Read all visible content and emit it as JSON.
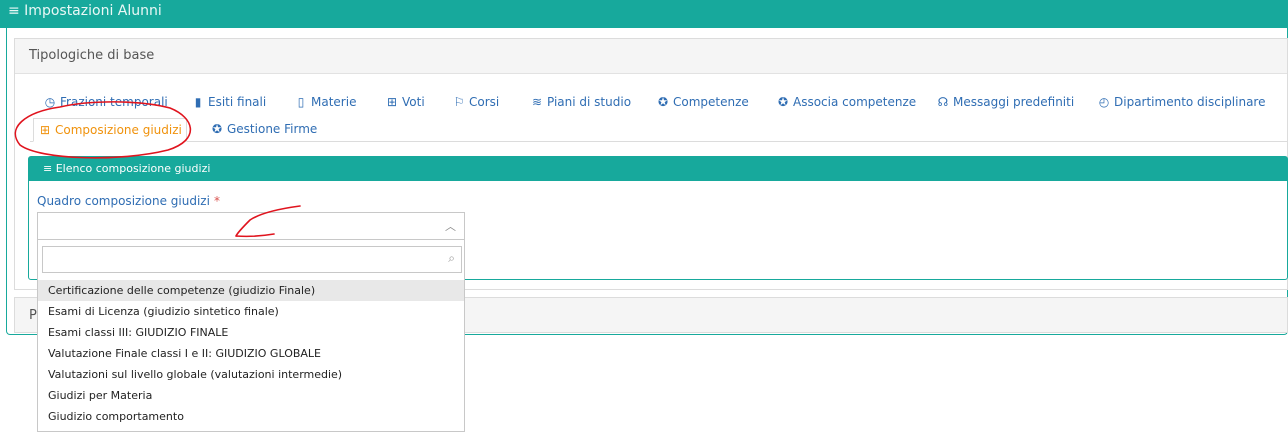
{
  "header": {
    "title": "≡ Impostazioni Alunni"
  },
  "section": {
    "title": "Tipologiche di base"
  },
  "tabs": [
    {
      "label": "Frazioni temporali",
      "icon": "clock-icon"
    },
    {
      "label": "Esiti finali",
      "icon": "bar-chart-icon"
    },
    {
      "label": "Materie",
      "icon": "book-icon"
    },
    {
      "label": "Voti",
      "icon": "calculator-icon"
    },
    {
      "label": "Corsi",
      "icon": "signpost-icon"
    },
    {
      "label": "Piani di studio",
      "icon": "layers-icon"
    },
    {
      "label": "Competenze",
      "icon": "award-icon"
    },
    {
      "label": "Associa competenze",
      "icon": "award-icon"
    },
    {
      "label": "Messaggi predefiniti",
      "icon": "headset-icon"
    },
    {
      "label": "Dipartimento disciplinare",
      "icon": "power-icon"
    },
    {
      "label": "Composizione giudizi",
      "icon": "grid-icon",
      "active": true
    },
    {
      "label": "Gestione Firme",
      "icon": "award-icon"
    }
  ],
  "panel": {
    "title": "≡ Elenco composizione giudizi",
    "field_label": "Quadro composizione giudizi",
    "required_mark": "*"
  },
  "dropdown": {
    "options": [
      "Certificazione delle competenze (giudizio Finale)",
      "Esami di Licenza (giudizio sintetico finale)",
      "Esami classi III: GIUDIZIO FINALE",
      "Valutazione Finale classi I e II: GIUDIZIO GLOBALE",
      "Valutazioni sul livello globale (valutazioni intermedie)",
      "Giudizi per Materia",
      "Giudizio comportamento"
    ],
    "highlighted_index": 0
  },
  "footer": {
    "partial_label": "Pa"
  },
  "colors": {
    "teal": "#17a99c",
    "link": "#2f6db3",
    "active": "#f0920c",
    "annotation": "#e0141e"
  }
}
